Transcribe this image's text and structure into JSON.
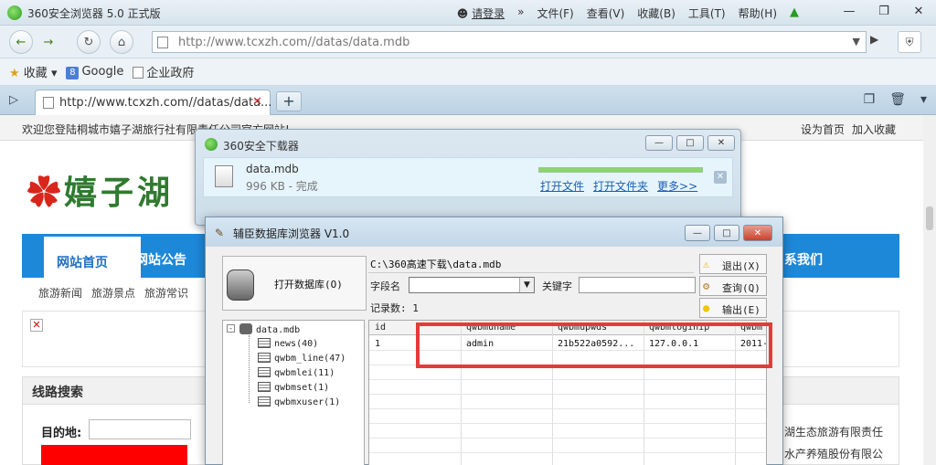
{
  "browser": {
    "title": "360安全浏览器 5.0 正式版",
    "login": "请登录",
    "menu": [
      "文件(F)",
      "查看(V)",
      "收藏(B)",
      "工具(T)",
      "帮助(H)"
    ],
    "url": "http://www.tcxzh.com//datas/data.mdb",
    "favorites_label": "收藏",
    "bookmarks": [
      "Google",
      "企业政府"
    ],
    "tab_label": "http://www.tcxzh.com//datas/data...",
    "new_tab": "+"
  },
  "site": {
    "welcome": "欢迎您登陆桐城市嬉子湖旅行社有限责任公司官方网站!",
    "set_home": "设为首页",
    "add_fav": "加入收藏",
    "logo_text": "嬉子湖",
    "nav": [
      "网站首页",
      "网站公告",
      "系我们"
    ],
    "subnav": [
      "旅游新闻",
      "旅游景点",
      "旅游常识"
    ],
    "route_title": "线路搜索",
    "dest_label": "目的地:",
    "side_texts": [
      "湖生态旅游有限责任",
      "水产养殖股份有限公"
    ]
  },
  "downloader": {
    "title": "360安全下载器",
    "filename": "data.mdb",
    "status": "996 KB - 完成",
    "progress": 1.0,
    "links": [
      "打开文件",
      "打开文件夹",
      "更多>>"
    ]
  },
  "dbbrowser": {
    "title": "辅臣数据库浏览器 V1.0",
    "open_label": "打开数据库(O)",
    "path": "C:\\360高速下载\\data.mdb",
    "field_label": "字段名",
    "keyword_label": "关键字",
    "count_label": "记录数: 1",
    "buttons": [
      "退出(X)",
      "查询(Q)",
      "输出(E)"
    ],
    "tree_root": "data.mdb",
    "tables": [
      "news(40)",
      "qwbm_line(47)",
      "qwbmlei(11)",
      "qwbmset(1)",
      "qwbmxuser(1)"
    ],
    "columns": [
      "id",
      "qwbmuname",
      "qwbmupwds",
      "qwbmloginip",
      "qwbm"
    ],
    "row": [
      "1",
      "admin",
      "21b522a0592...",
      "127.0.0.1",
      "2011-"
    ]
  },
  "colors": {
    "nav_blue": "#1e88d8",
    "highlight_red": "#e53a3a",
    "logo_green": "#2f7a2f"
  }
}
